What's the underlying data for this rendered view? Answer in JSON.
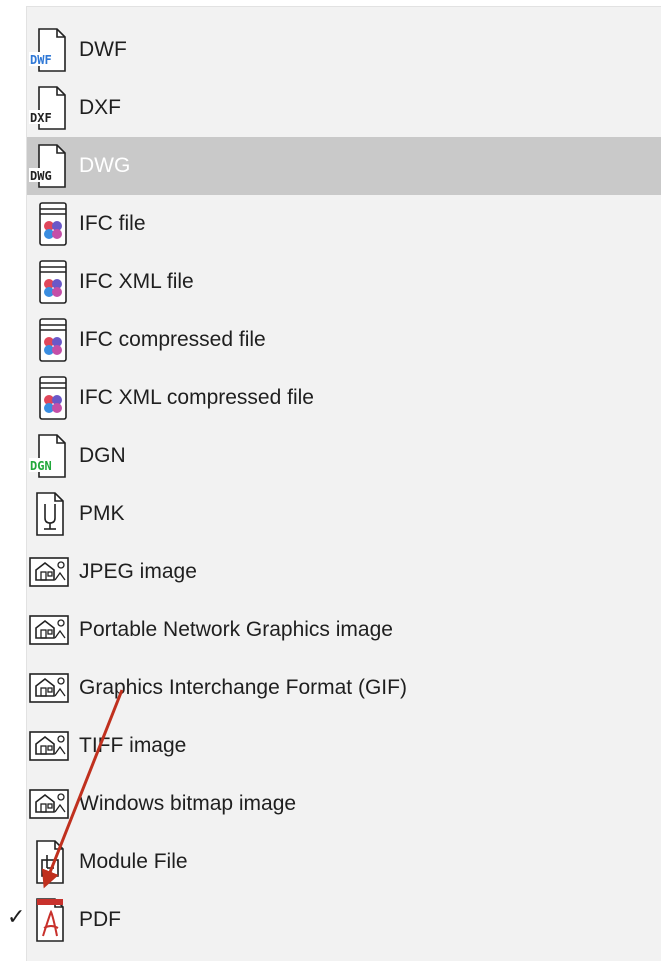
{
  "menu": {
    "items": [
      {
        "label": "DWF",
        "icon": "dwf-file-icon",
        "icon_text": "DWF",
        "icon_text_color": "#2f78d6"
      },
      {
        "label": "DXF",
        "icon": "dxf-file-icon",
        "icon_text": "DXF",
        "icon_text_color": "#222222"
      },
      {
        "label": "DWG",
        "icon": "dwg-file-icon",
        "icon_text": "DWG",
        "icon_text_color": "#222222",
        "state": "highlighted"
      },
      {
        "label": "IFC file",
        "icon": "ifc-file-icon"
      },
      {
        "label": "IFC XML file",
        "icon": "ifc-file-icon"
      },
      {
        "label": "IFC compressed file",
        "icon": "ifc-file-icon"
      },
      {
        "label": "IFC XML compressed file",
        "icon": "ifc-file-icon"
      },
      {
        "label": "DGN",
        "icon": "dgn-file-icon",
        "icon_text": "DGN",
        "icon_text_color": "#21a83b"
      },
      {
        "label": "PMK",
        "icon": "pmk-file-icon"
      },
      {
        "label": "JPEG image",
        "icon": "image-file-icon"
      },
      {
        "label": "Portable Network Graphics image",
        "icon": "image-file-icon"
      },
      {
        "label": "Graphics Interchange Format (GIF)",
        "icon": "image-file-icon"
      },
      {
        "label": "TIFF image",
        "icon": "image-file-icon"
      },
      {
        "label": "Windows bitmap image",
        "icon": "image-file-icon"
      },
      {
        "label": "Module File",
        "icon": "module-file-icon"
      },
      {
        "label": "PDF",
        "icon": "pdf-file-icon",
        "checked": true
      }
    ],
    "checkmark": "✓"
  },
  "colors": {
    "menu_background": "#f2f2f2",
    "highlight_background": "#c9c9c9",
    "annotation_arrow": "#c0301e"
  }
}
